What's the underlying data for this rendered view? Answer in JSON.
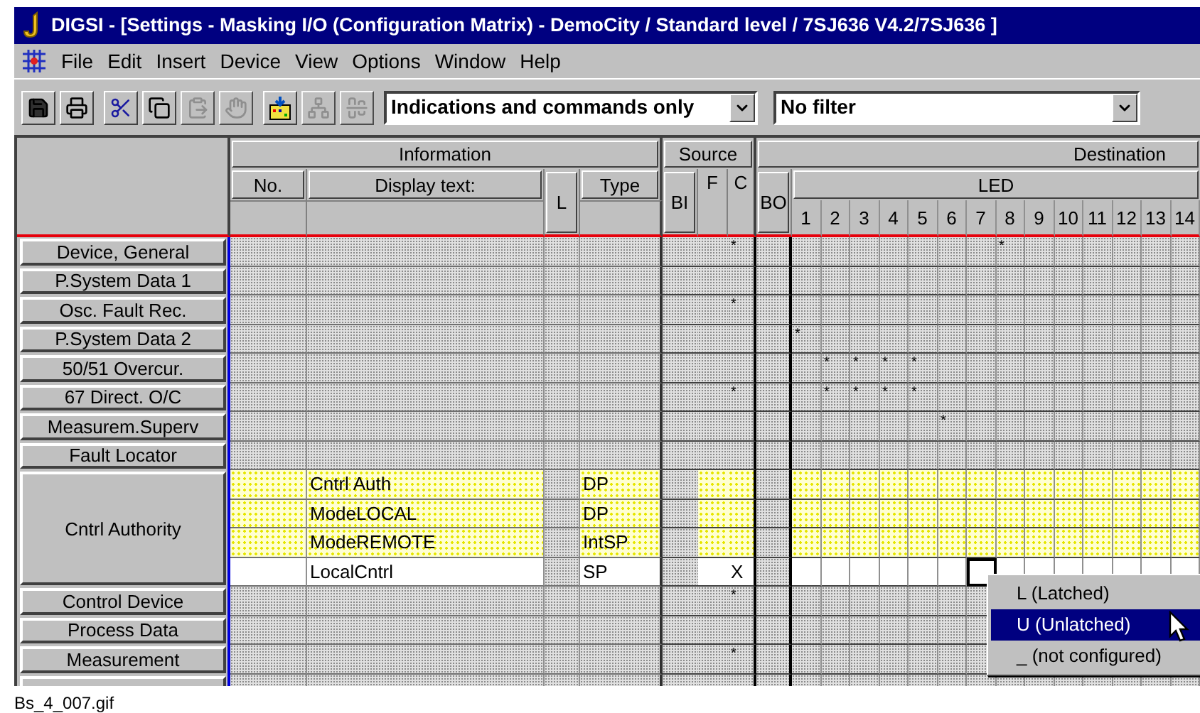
{
  "window": {
    "title": "DIGSI - [Settings - Masking I/O (Configuration Matrix) - DemoCity / Standard level / 7SJ636 V4.2/7SJ636 ]"
  },
  "menu": [
    "File",
    "Edit",
    "Insert",
    "Device",
    "View",
    "Options",
    "Window",
    "Help"
  ],
  "toolbar": [
    {
      "buttons": [
        {
          "kind": "save",
          "disabled": false
        },
        {
          "kind": "print",
          "disabled": false
        }
      ]
    },
    {
      "buttons": [
        {
          "kind": "cut",
          "disabled": false
        },
        {
          "kind": "copy",
          "disabled": false
        },
        {
          "kind": "paste",
          "disabled": true
        },
        {
          "kind": "hand",
          "disabled": true
        }
      ]
    },
    {
      "buttons": [
        {
          "kind": "matrix",
          "disabled": false
        },
        {
          "kind": "network",
          "disabled": true
        },
        {
          "kind": "align",
          "disabled": true
        }
      ]
    }
  ],
  "filters": [
    {
      "value": "Indications and commands only"
    },
    {
      "value": "No filter"
    }
  ],
  "matrix": {
    "groups": [
      "Information",
      "Source",
      "Destination"
    ],
    "columns": [
      {
        "label": "No.",
        "kind": "split",
        "masked": false
      },
      {
        "label": "Display text:",
        "kind": "split",
        "masked": false
      },
      {
        "label": "L",
        "kind": "tall",
        "masked": true
      },
      {
        "label": "Type",
        "kind": "split",
        "masked": false
      },
      {
        "label": "BI",
        "kind": "tall",
        "masked": true
      },
      {
        "label": "F",
        "kind": "flat",
        "masked": false
      },
      {
        "label": "C",
        "kind": "flat",
        "masked": false
      },
      {
        "label": "BO",
        "kind": "tall",
        "masked": true
      }
    ],
    "led": {
      "label": "LED",
      "numbers": [
        "1",
        "2",
        "3",
        "4",
        "5",
        "6",
        "7",
        "8",
        "9",
        "10",
        "11",
        "12",
        "13",
        "14"
      ]
    },
    "row_groups": [
      {
        "label": "Device, General",
        "rows": [
          {
            "kind": "masked",
            "cells": [
              null,
              null,
              "*",
              null,
              null,
              null,
              null,
              null,
              null,
              null,
              null,
              "*",
              null,
              null,
              null,
              null,
              null,
              null
            ]
          }
        ]
      },
      {
        "label": "P.System Data 1",
        "rows": [
          {
            "kind": "masked",
            "cells": [
              null,
              null,
              null,
              null,
              null,
              null,
              null,
              null,
              null,
              null,
              null,
              null,
              null,
              null,
              null,
              null,
              null,
              null
            ]
          }
        ]
      },
      {
        "label": "Osc. Fault Rec.",
        "rows": [
          {
            "kind": "masked",
            "cells": [
              null,
              null,
              "*",
              null,
              null,
              null,
              null,
              null,
              null,
              null,
              null,
              null,
              null,
              null,
              null,
              null,
              null,
              null
            ]
          }
        ]
      },
      {
        "label": "P.System Data 2",
        "rows": [
          {
            "kind": "masked",
            "cells": [
              null,
              null,
              null,
              null,
              "*",
              null,
              null,
              null,
              null,
              null,
              null,
              null,
              null,
              null,
              null,
              null,
              null,
              null
            ]
          }
        ]
      },
      {
        "label": "50/51 Overcur.",
        "rows": [
          {
            "kind": "masked",
            "cells": [
              null,
              null,
              null,
              null,
              null,
              "*",
              "*",
              "*",
              "*",
              null,
              null,
              null,
              null,
              null,
              null,
              null,
              null,
              null
            ]
          }
        ]
      },
      {
        "label": "67 Direct. O/C",
        "rows": [
          {
            "kind": "masked",
            "cells": [
              null,
              null,
              "*",
              null,
              null,
              "*",
              "*",
              "*",
              "*",
              null,
              null,
              null,
              null,
              null,
              null,
              null,
              null,
              null
            ]
          }
        ]
      },
      {
        "label": "Measurem.Superv",
        "rows": [
          {
            "kind": "masked",
            "cells": [
              null,
              null,
              null,
              null,
              null,
              null,
              null,
              null,
              null,
              "*",
              null,
              null,
              null,
              null,
              null,
              null,
              null,
              null
            ]
          }
        ]
      },
      {
        "label": "Fault Locator",
        "rows": [
          {
            "kind": "masked",
            "cells": [
              null,
              null,
              null,
              null,
              null,
              null,
              null,
              null,
              null,
              null,
              null,
              null,
              null,
              null,
              null,
              null,
              null,
              null
            ]
          }
        ]
      },
      {
        "label": "Cntrl Authority",
        "rows": [
          {
            "kind": "highlighted",
            "text": "Cntrl Auth",
            "type": "DP",
            "cells": [
              null,
              null,
              null,
              null,
              null,
              null,
              null,
              null,
              null,
              null,
              null,
              null,
              null,
              null,
              null,
              null,
              null,
              null
            ]
          },
          {
            "kind": "highlighted",
            "text": "ModeLOCAL",
            "type": "DP",
            "cells": [
              null,
              null,
              null,
              null,
              null,
              null,
              null,
              null,
              null,
              null,
              null,
              null,
              null,
              null,
              null,
              null,
              null,
              null
            ]
          },
          {
            "kind": "highlighted",
            "text": "ModeREMOTE",
            "type": "IntSP",
            "cells": [
              null,
              null,
              null,
              null,
              null,
              null,
              null,
              null,
              null,
              null,
              null,
              null,
              null,
              null,
              null,
              null,
              null,
              null
            ]
          },
          {
            "kind": "plain",
            "text": "LocalCntrl",
            "type": "SP",
            "cells": [
              null,
              null,
              "X",
              null,
              null,
              null,
              null,
              null,
              null,
              null,
              null,
              null,
              null,
              null,
              null,
              null,
              null,
              null
            ],
            "focus": [
              false,
              false,
              false,
              false,
              false,
              false,
              false,
              false,
              false,
              false,
              true,
              false,
              false,
              false,
              false,
              false,
              false,
              false
            ]
          }
        ]
      },
      {
        "label": "Control Device",
        "rows": [
          {
            "kind": "masked",
            "cells": [
              null,
              null,
              "*",
              null,
              null,
              null,
              null,
              null,
              null,
              null,
              null,
              null,
              null,
              null,
              null,
              null,
              null,
              null
            ]
          }
        ]
      },
      {
        "label": "Process Data",
        "rows": [
          {
            "kind": "masked",
            "cells": [
              null,
              null,
              null,
              null,
              null,
              null,
              null,
              null,
              null,
              null,
              null,
              null,
              null,
              null,
              null,
              null,
              null,
              null
            ]
          }
        ]
      },
      {
        "label": "Measurement",
        "rows": [
          {
            "kind": "masked",
            "cells": [
              null,
              null,
              "*",
              null,
              null,
              null,
              null,
              null,
              null,
              null,
              null,
              null,
              null,
              null,
              null,
              null,
              null,
              null
            ]
          }
        ]
      },
      {
        "rows": [
          {
            "kind": "masked",
            "cells": [
              null,
              null,
              null,
              null,
              null,
              null,
              null,
              null,
              null,
              null,
              null,
              null,
              null,
              null,
              null,
              null,
              null,
              null
            ]
          }
        ]
      }
    ]
  },
  "popup_menu": [
    {
      "label": "L (Latched)",
      "selected": false
    },
    {
      "label": "U (Unlatched)",
      "selected": true
    },
    {
      "label": "_ (not configured)",
      "selected": false
    }
  ],
  "caption": "Bs_4_007.gif"
}
